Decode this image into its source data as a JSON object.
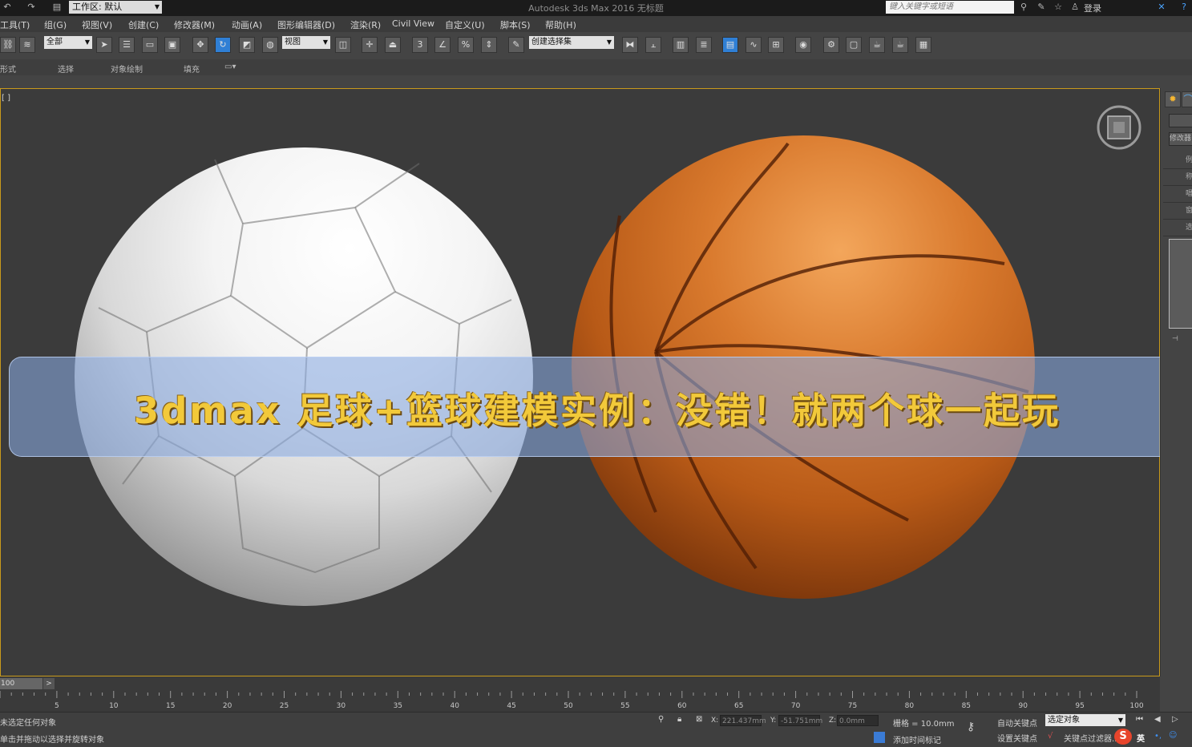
{
  "titlebar": {
    "title": "Autodesk 3ds Max 2016     无标题",
    "workspace": "工作区: 默认",
    "search_placeholder": "键入关键字或短语",
    "login": "登录"
  },
  "menu": [
    "工具(T)",
    "组(G)",
    "视图(V)",
    "创建(C)",
    "修改器(M)",
    "动画(A)",
    "图形编辑器(D)",
    "渲染(R)",
    "Civil View",
    "自定义(U)",
    "脚本(S)",
    "帮助(H)"
  ],
  "toolbar": {
    "filter": "全部",
    "coord_system": "视图",
    "selection_set": "创建选择集",
    "snap_angle": "3",
    "percent": "%"
  },
  "ribbon": [
    "形式",
    "选择",
    "对象绘制",
    "填充"
  ],
  "viewport": {
    "label": "[ ]",
    "banner": "3dmax 足球+篮球建模实例：没错！就两个球一起玩",
    "accent_color": "#c99a1b"
  },
  "right_panel": {
    "modifier_list": "修改器",
    "tabs": [
      "例",
      "称",
      "唱",
      "窗",
      "选"
    ]
  },
  "timeline": {
    "frame": "100",
    "next": ">",
    "ticks": [
      "5",
      "10",
      "15",
      "20",
      "25",
      "30",
      "35",
      "40",
      "45",
      "50",
      "55",
      "60",
      "65",
      "70",
      "75",
      "80",
      "85",
      "90",
      "95",
      "100"
    ]
  },
  "status": {
    "line1": "未选定任何对象",
    "line2": "单击并拖动以选择并旋转对象",
    "x_label": "X:",
    "x_value": "221.437mm",
    "y_label": "Y:",
    "y_value": "-51.751mm",
    "z_label": "Z:",
    "z_value": "0.0mm",
    "grid": "栅格 = 10.0mm",
    "add_time_tag": "添加时间标记",
    "auto_key": "自动关键点",
    "set_key": "设置关键点",
    "selected_object": "选定对象",
    "key_filter": "关键点过滤器...",
    "ime": "英"
  }
}
